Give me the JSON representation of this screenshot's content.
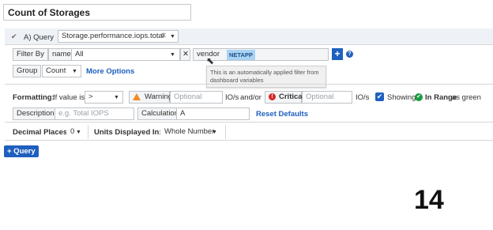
{
  "title": "Count of Storages",
  "query": {
    "prefix": "A) Query",
    "metric": "Storage.performance.iops.total",
    "filter_by_label": "Filter By",
    "filter_attr": "name",
    "filter_value": "All",
    "vendor_label": "vendor",
    "vendor_tag": "NETAPP",
    "tooltip": "This is an automatically applied filter from dashboard variables",
    "group_label": "Group",
    "group_value": "Count",
    "more_options": "More Options"
  },
  "formatting": {
    "label": "Formatting:",
    "if_value_is": "If value is",
    "operator": ">",
    "warning_label": "Warning",
    "warning_placeholder": "Optional",
    "unit1": "IO/s",
    "andor": "and/or",
    "critical_label": "Critical",
    "critical_placeholder": "Optional",
    "unit2": "IO/s",
    "showing": "Showing",
    "in_range": "In Range",
    "as_green": "as green",
    "description_label": "Description",
    "description_placeholder": "e.g. Total IOPS",
    "calculation_label": "Calculation",
    "calculation_value": "A",
    "reset_defaults": "Reset Defaults"
  },
  "display": {
    "decimal_label": "Decimal Places:",
    "decimal_value": "0",
    "units_label": "Units Displayed In:",
    "units_value": "Whole Number"
  },
  "add_query": "+ Query",
  "big_number": "14",
  "colors": {
    "accent": "#1f5fbf",
    "warning": "#f08a24",
    "critical": "#d62828",
    "ok": "#1c9b3f",
    "tag_bg": "#a8d3f5"
  },
  "icons": [
    "check-icon",
    "close-icon",
    "chevron-down-icon",
    "plus-icon",
    "help-icon",
    "warning-icon",
    "critical-icon",
    "checkbox-icon",
    "ok-icon",
    "cursor-icon"
  ]
}
